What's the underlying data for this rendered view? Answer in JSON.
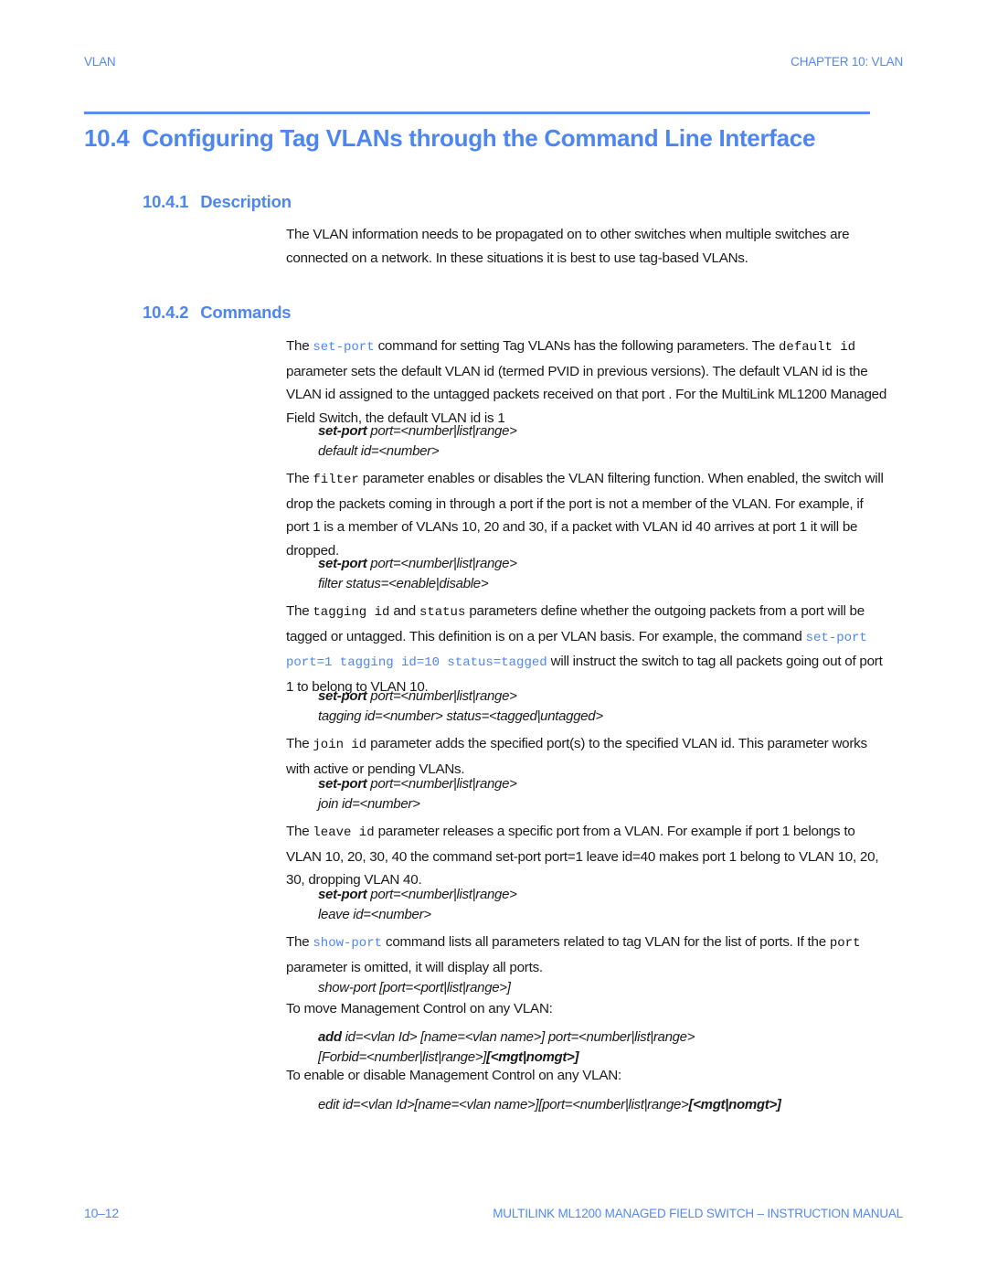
{
  "running_head": {
    "left": "VLAN",
    "right": "CHAPTER 10: VLAN"
  },
  "heading1": {
    "number": "10.4",
    "title": "Configuring Tag VLANs through the Command Line Interface"
  },
  "sections": {
    "description": {
      "number": "10.4.1",
      "title": "Description",
      "paragraph": "The VLAN information needs to be propagated on to other switches when multiple switches are connected on a network. In these situations it is best to use tag-based VLANs."
    },
    "commands": {
      "number": "10.4.2",
      "title": "Commands"
    }
  },
  "commands_body": {
    "setport": {
      "p1_a": "The ",
      "p1_code1": "set-port",
      "p1_b": " command for setting Tag VLANs has the following parameters. The ",
      "p1_code2": "default id",
      "p1_c": " parameter sets the default VLAN id (termed PVID in previous versions). The default VLAN id is the VLAN id assigned to the untagged packets received on that port . For the MultiLink ML1200 Managed Field Switch, the default VLAN id is 1",
      "syntax_line1_cmd": "set-port",
      "syntax_line1_rest": " port=<number|list|range>",
      "syntax_line2": "default id=<number>"
    },
    "filter": {
      "p_a": "The ",
      "p_code": "filter",
      "p_b": " parameter enables or disables the VLAN filtering function. When enabled, the switch will drop the packets coming in through a port if the port is not a member of the VLAN. For example, if port 1 is a member of VLANs 10, 20 and 30, if a packet with VLAN id 40 arrives at port 1 it will be dropped.",
      "syntax_line1_cmd": "set-port",
      "syntax_line1_rest": " port=<number|list|range>",
      "syntax_line2": "filter status=<enable|disable>"
    },
    "tagging": {
      "p_a": "The ",
      "p_code1": "tagging id",
      "p_b": " and ",
      "p_code2": "status",
      "p_c": " parameters define whether the outgoing packets from a port will be tagged or untagged. This definition is on a per VLAN basis. For example, the command ",
      "p_code3": "set-port port=1 tagging id=10 status=tagged",
      "p_d": " will instruct the switch to tag all packets going out of port 1 to belong to VLAN 10.",
      "syntax_line1_cmd": "set-port",
      "syntax_line1_rest": " port=<number|list|range>",
      "syntax_line2": "tagging id=<number> status=<tagged|untagged>"
    },
    "join": {
      "p_a": "The ",
      "p_code": "join id",
      "p_b": " parameter adds the specified port(s) to the specified VLAN id. This parameter works with active or pending VLANs.",
      "syntax_line1_cmd": "set-port",
      "syntax_line1_rest": " port=<number|list|range>",
      "syntax_line2": "join id=<number>"
    },
    "leave": {
      "p_a": "The ",
      "p_code": "leave id",
      "p_b": " parameter releases a specific port from a VLAN. For example if port 1 belongs to VLAN 10, 20, 30, 40 the command set-port port=1 leave id=40 makes port 1 belong to VLAN 10, 20, 30, dropping VLAN 40.",
      "syntax_line1_cmd": "set-port",
      "syntax_line1_rest": " port=<number|list|range>",
      "syntax_line2": "leave id=<number>"
    },
    "showport": {
      "p_a": "The ",
      "p_code1": "show-port",
      "p_b": " command lists all parameters related to tag VLAN for the list of ports. If the ",
      "p_code2": "port",
      "p_c": " parameter is omitted, it will display all ports.",
      "syntax_line1": "show-port [port=<port|list|range>]"
    },
    "move_mgmt": {
      "intro": "To move Management Control on any VLAN:",
      "syntax_line1_cmd": "add",
      "syntax_line1_rest": " id=<vlan Id> [name=<vlan name>] port=<number|list|range>",
      "syntax_line2_a": "[Forbid=<number|list|range>]",
      "syntax_line2_b": "[<mgt|nomgt>]"
    },
    "enable_mgmt": {
      "intro": "To enable or disable Management Control on any VLAN:",
      "syntax_line1_a": "edit id=<vlan Id>[name=<vlan name>][port=<number|list|range>",
      "syntax_line1_b": "[<mgt|nomgt>]"
    }
  },
  "footer": {
    "page_number": "10–12",
    "manual": "MULTILINK ML1200 MANAGED FIELD SWITCH – INSTRUCTION MANUAL"
  },
  "colors": {
    "accent_blue": "#4d86f0",
    "rule_blue": "#5b8cf5",
    "body_text": "#1a1a1a"
  }
}
